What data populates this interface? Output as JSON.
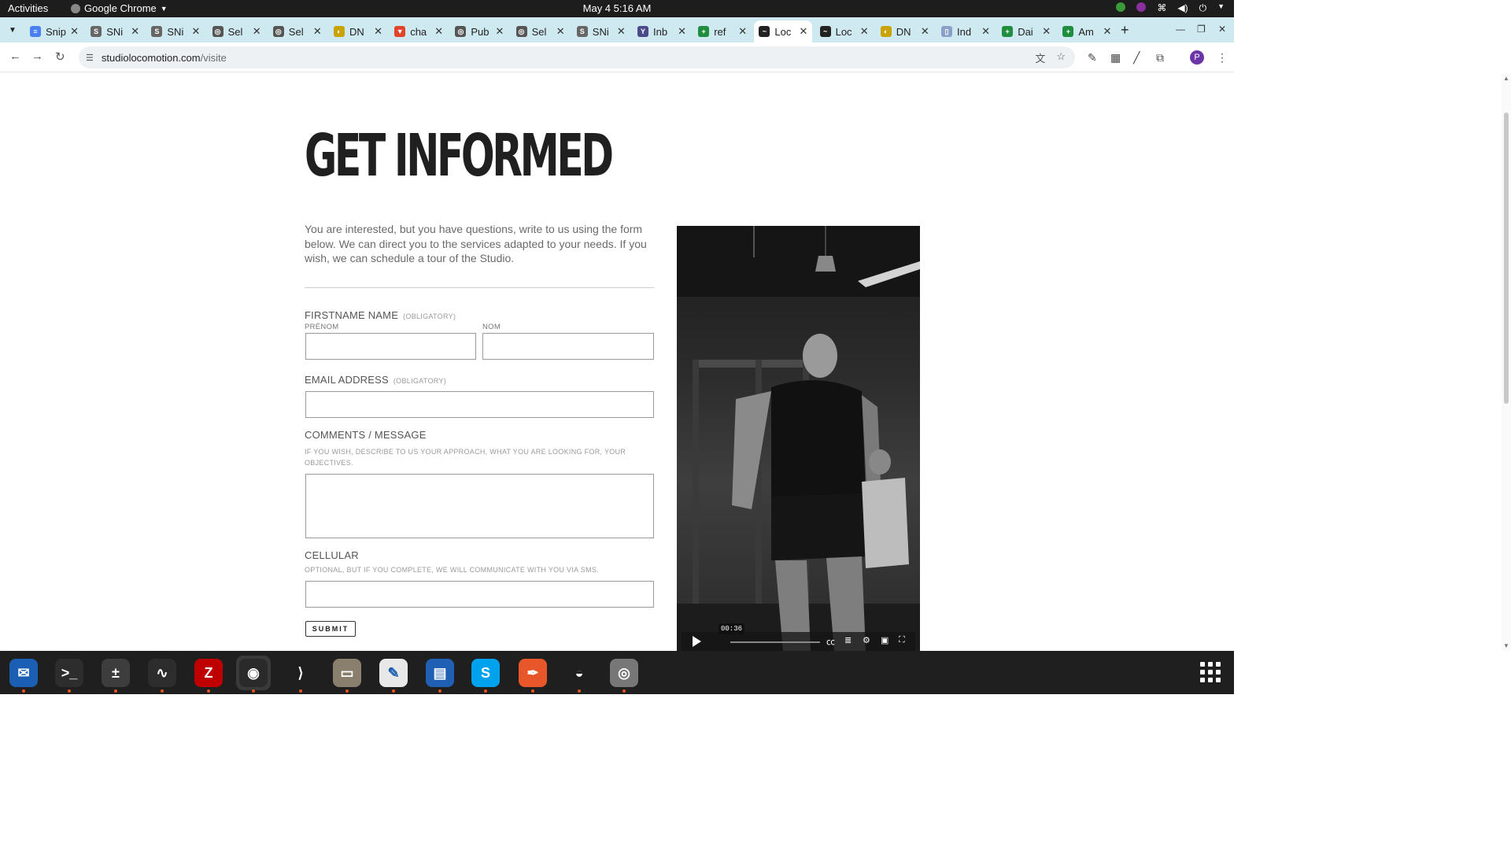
{
  "system": {
    "activities": "Activities",
    "app_name": "Google Chrome",
    "clock": "May 4  5:16 AM"
  },
  "tabs": [
    {
      "title": "Snip",
      "color": "#4a80f0",
      "glyph": "≡"
    },
    {
      "title": "SNi",
      "color": "#666666",
      "glyph": "S"
    },
    {
      "title": "SNi",
      "color": "#666666",
      "glyph": "S"
    },
    {
      "title": "Sel",
      "color": "#555555",
      "glyph": "◎"
    },
    {
      "title": "Sel",
      "color": "#555555",
      "glyph": "◎"
    },
    {
      "title": "DN",
      "color": "#c9a400",
      "glyph": "◐"
    },
    {
      "title": "cha",
      "color": "#e24329",
      "glyph": "▼"
    },
    {
      "title": "Pub",
      "color": "#555555",
      "glyph": "◎"
    },
    {
      "title": "Sel",
      "color": "#555555",
      "glyph": "◎"
    },
    {
      "title": "SNi",
      "color": "#666666",
      "glyph": "S"
    },
    {
      "title": "Inb",
      "color": "#4a4a8a",
      "glyph": "Y"
    },
    {
      "title": "ref",
      "color": "#1e8e3e",
      "glyph": "+"
    },
    {
      "title": "Loc",
      "color": "#222222",
      "glyph": "~",
      "active": true
    },
    {
      "title": "Loc",
      "color": "#222222",
      "glyph": "~"
    },
    {
      "title": "DN",
      "color": "#c9a400",
      "glyph": "◐"
    },
    {
      "title": "Ind",
      "color": "#8aa0c8",
      "glyph": "▯"
    },
    {
      "title": "Dai",
      "color": "#1e8e3e",
      "glyph": "+"
    },
    {
      "title": "Am",
      "color": "#1e8e3e",
      "glyph": "+"
    }
  ],
  "url": {
    "domain": "studiolocomotion.com",
    "path": "/visite"
  },
  "page": {
    "heading": "GET INFORMED",
    "intro": "You are interested, but you have questions, write to us using the form below. We can direct you to the services adapted to your needs. If you wish, we can schedule a tour of the Studio.",
    "form": {
      "name_label": "FIRSTNAME NAME",
      "obligatory": "(OBLIGATORY)",
      "firstname_sublabel": "PRÉNOM",
      "lastname_sublabel": "NOM",
      "email_label": "EMAIL ADDRESS",
      "email_obligatory": "(OBLIGATORY)",
      "comments_label": "COMMENTS / MESSAGE",
      "comments_hint": "IF YOU WISH, DESCRIBE TO US YOUR APPROACH, WHAT YOU ARE LOOKING FOR, YOUR OBJECTIVES.",
      "cellular_label": "CELLULAR",
      "cellular_hint": "OPTIONAL, BUT IF YOU COMPLETE, WE WILL COMMUNICATE WITH YOU VIA SMS.",
      "firstname_value": "",
      "lastname_value": "",
      "email_value": "",
      "comments_value": "",
      "cellular_value": "",
      "submit_label": "SUBMIT"
    },
    "video": {
      "time": "00:36",
      "progress": 0
    }
  },
  "dock": [
    {
      "name": "thunderbird",
      "color": "#1a5fb4",
      "glyph": "✉"
    },
    {
      "name": "terminal",
      "color": "#2d2d2d",
      "glyph": ">_"
    },
    {
      "name": "calculator",
      "color": "#3d3d3d",
      "glyph": "±"
    },
    {
      "name": "system-monitor",
      "color": "#2d2d2d",
      "glyph": "∿"
    },
    {
      "name": "filezilla",
      "color": "#bf0000",
      "glyph": "Z"
    },
    {
      "name": "chrome",
      "color": "#2a2a2a",
      "glyph": "◉",
      "selected": true
    },
    {
      "name": "vscode",
      "color": "#1f1f1f",
      "glyph": "⟩"
    },
    {
      "name": "files",
      "color": "#8a7f6c",
      "glyph": "▭"
    },
    {
      "name": "text-editor",
      "color": "#e8e8e8",
      "glyph": "✎"
    },
    {
      "name": "writer",
      "color": "#1f5fb4",
      "glyph": "▤"
    },
    {
      "name": "skype",
      "color": "#00a2ed",
      "glyph": "S"
    },
    {
      "name": "inkscape",
      "color": "#e8572a",
      "glyph": "✒"
    },
    {
      "name": "blender",
      "color": "#1f1f1f",
      "glyph": "◒"
    },
    {
      "name": "disks",
      "color": "#777777",
      "glyph": "◎"
    }
  ]
}
